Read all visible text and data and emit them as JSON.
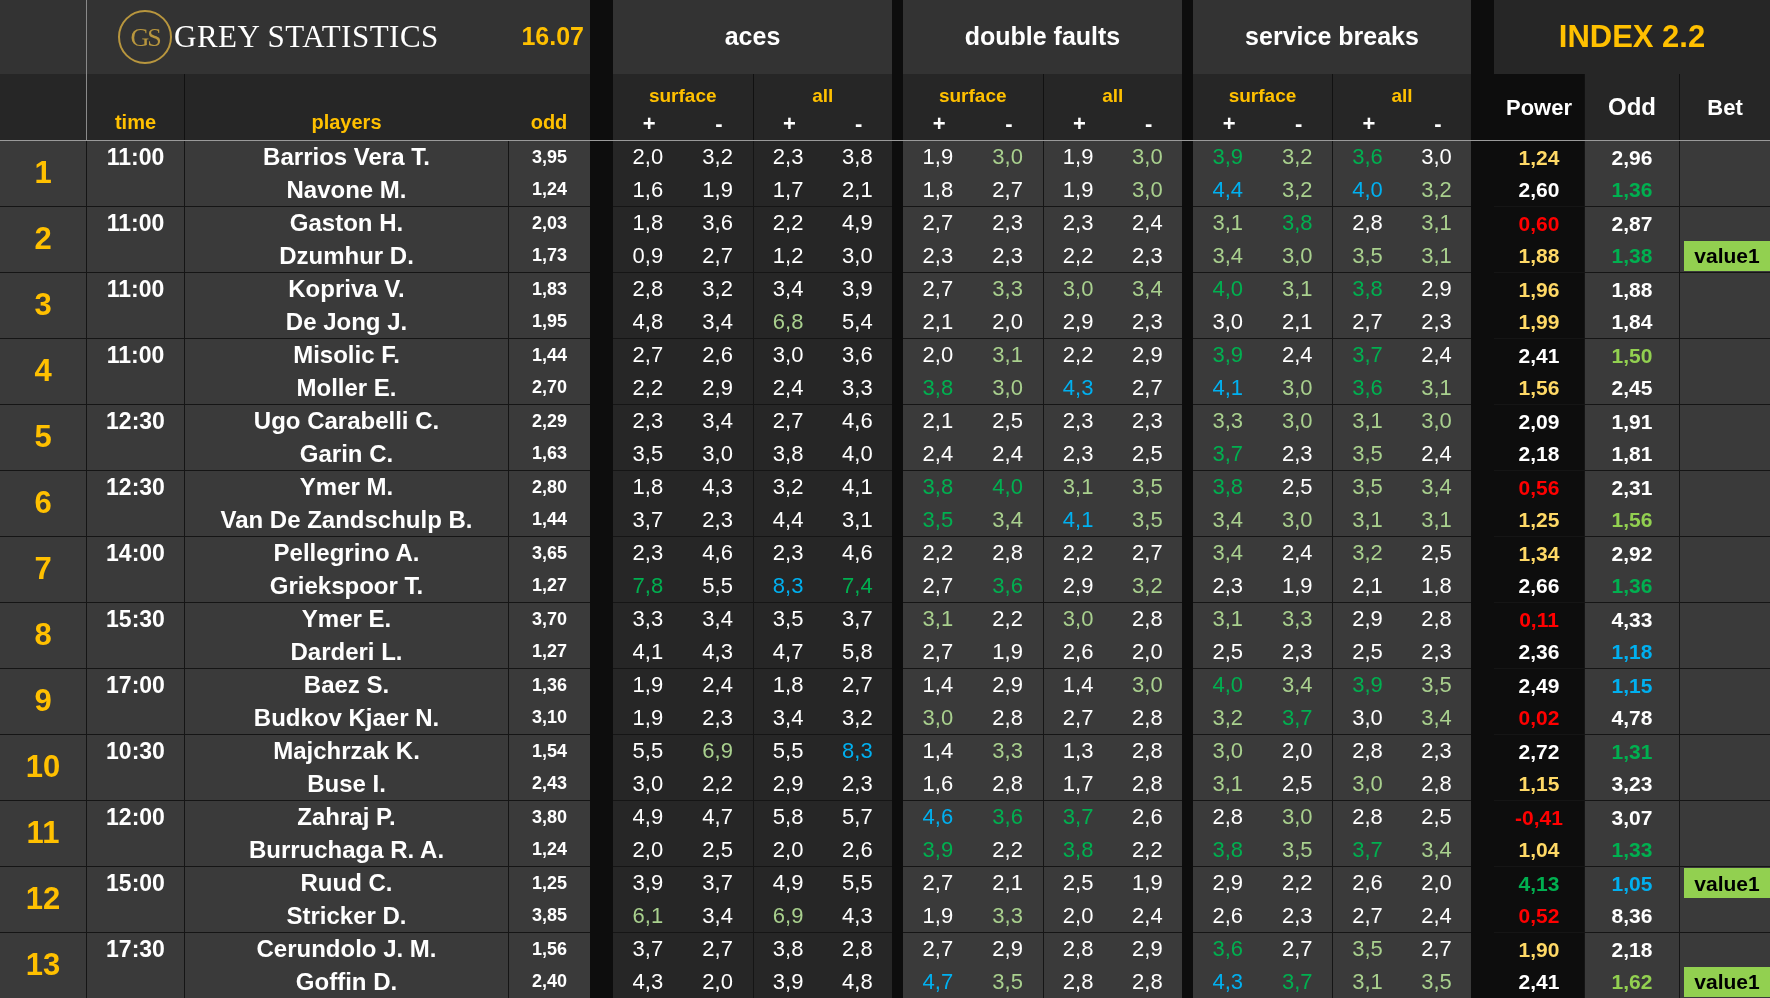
{
  "header": {
    "logo_mark": "GS",
    "brand": "GREY STATISTICS",
    "date": "16.07",
    "index_title": "INDEX 2.2",
    "groups": [
      {
        "title": "aces",
        "subs": [
          {
            "label": "surface",
            "signs": [
              "+",
              "-"
            ]
          },
          {
            "label": "all",
            "signs": [
              "+",
              "-"
            ]
          }
        ]
      },
      {
        "title": "double faults",
        "subs": [
          {
            "label": "surface",
            "signs": [
              "+",
              "-"
            ]
          },
          {
            "label": "all",
            "signs": [
              "+",
              "-"
            ]
          }
        ]
      },
      {
        "title": "service breaks",
        "subs": [
          {
            "label": "surface",
            "signs": [
              "+",
              "-"
            ]
          },
          {
            "label": "all",
            "signs": [
              "+",
              "-"
            ]
          }
        ]
      }
    ],
    "columns": {
      "time": "time",
      "players": "players",
      "odd": "odd",
      "power": "Power",
      "index_odd": "Odd",
      "bet": "Bet"
    }
  },
  "matches": [
    {
      "rank": "1",
      "time": "11:00",
      "players": [
        {
          "name": "Barrios Vera T.",
          "odd": "3,95",
          "stats": [
            {
              "text": "2,0",
              "color": "#ffffff"
            },
            {
              "text": "3,2",
              "color": "#ffffff"
            },
            {
              "text": "2,3",
              "color": "#ffffff"
            },
            {
              "text": "3,8",
              "color": "#ffffff"
            },
            {
              "text": "1,9",
              "color": "#ffffff"
            },
            {
              "text": "3,0",
              "color": "#a9d08e"
            },
            {
              "text": "1,9",
              "color": "#ffffff"
            },
            {
              "text": "3,0",
              "color": "#a9d08e"
            },
            {
              "text": "3,9",
              "color": "#00b050"
            },
            {
              "text": "3,2",
              "color": "#a9d08e"
            },
            {
              "text": "3,6",
              "color": "#00b050"
            },
            {
              "text": "3,0",
              "color": "#ffffff"
            }
          ],
          "power": {
            "text": "1,24",
            "color": "#ffd966"
          },
          "index_odd": {
            "text": "2,96",
            "color": "#ffffff"
          }
        },
        {
          "name": "Navone M.",
          "odd": "1,24",
          "stats": [
            {
              "text": "1,6",
              "color": "#ffffff"
            },
            {
              "text": "1,9",
              "color": "#ffffff"
            },
            {
              "text": "1,7",
              "color": "#ffffff"
            },
            {
              "text": "2,1",
              "color": "#ffffff"
            },
            {
              "text": "1,8",
              "color": "#ffffff"
            },
            {
              "text": "2,7",
              "color": "#ffffff"
            },
            {
              "text": "1,9",
              "color": "#ffffff"
            },
            {
              "text": "3,0",
              "color": "#a9d08e"
            },
            {
              "text": "4,4",
              "color": "#00b0f0"
            },
            {
              "text": "3,2",
              "color": "#a9d08e"
            },
            {
              "text": "4,0",
              "color": "#00b0f0"
            },
            {
              "text": "3,2",
              "color": "#a9d08e"
            }
          ],
          "power": {
            "text": "2,60",
            "color": "#ffffff"
          },
          "index_odd": {
            "text": "1,36",
            "color": "#00b050"
          }
        }
      ]
    },
    {
      "rank": "2",
      "time": "11:00",
      "players": [
        {
          "name": "Gaston H.",
          "odd": "2,03",
          "stats": [
            {
              "text": "1,8",
              "color": "#ffffff"
            },
            {
              "text": "3,6",
              "color": "#ffffff"
            },
            {
              "text": "2,2",
              "color": "#ffffff"
            },
            {
              "text": "4,9",
              "color": "#ffffff"
            },
            {
              "text": "2,7",
              "color": "#ffffff"
            },
            {
              "text": "2,3",
              "color": "#ffffff"
            },
            {
              "text": "2,3",
              "color": "#ffffff"
            },
            {
              "text": "2,4",
              "color": "#ffffff"
            },
            {
              "text": "3,1",
              "color": "#a9d08e"
            },
            {
              "text": "3,8",
              "color": "#00b050"
            },
            {
              "text": "2,8",
              "color": "#ffffff"
            },
            {
              "text": "3,1",
              "color": "#a9d08e"
            }
          ],
          "power": {
            "text": "0,60",
            "color": "#ff0000"
          },
          "index_odd": {
            "text": "2,87",
            "color": "#ffffff"
          }
        },
        {
          "name": "Dzumhur D.",
          "odd": "1,73",
          "stats": [
            {
              "text": "0,9",
              "color": "#ffffff"
            },
            {
              "text": "2,7",
              "color": "#ffffff"
            },
            {
              "text": "1,2",
              "color": "#ffffff"
            },
            {
              "text": "3,0",
              "color": "#ffffff"
            },
            {
              "text": "2,3",
              "color": "#ffffff"
            },
            {
              "text": "2,3",
              "color": "#ffffff"
            },
            {
              "text": "2,2",
              "color": "#ffffff"
            },
            {
              "text": "2,3",
              "color": "#ffffff"
            },
            {
              "text": "3,4",
              "color": "#a9d08e"
            },
            {
              "text": "3,0",
              "color": "#a9d08e"
            },
            {
              "text": "3,5",
              "color": "#a9d08e"
            },
            {
              "text": "3,1",
              "color": "#a9d08e"
            }
          ],
          "power": {
            "text": "1,88",
            "color": "#ffd966"
          },
          "index_odd": {
            "text": "1,38",
            "color": "#00b050"
          },
          "bet": "value1"
        }
      ]
    },
    {
      "rank": "3",
      "time": "11:00",
      "players": [
        {
          "name": "Kopriva V.",
          "odd": "1,83",
          "stats": [
            {
              "text": "2,8",
              "color": "#ffffff"
            },
            {
              "text": "3,2",
              "color": "#ffffff"
            },
            {
              "text": "3,4",
              "color": "#ffffff"
            },
            {
              "text": "3,9",
              "color": "#ffffff"
            },
            {
              "text": "2,7",
              "color": "#ffffff"
            },
            {
              "text": "3,3",
              "color": "#a9d08e"
            },
            {
              "text": "3,0",
              "color": "#a9d08e"
            },
            {
              "text": "3,4",
              "color": "#a9d08e"
            },
            {
              "text": "4,0",
              "color": "#00b050"
            },
            {
              "text": "3,1",
              "color": "#a9d08e"
            },
            {
              "text": "3,8",
              "color": "#00b050"
            },
            {
              "text": "2,9",
              "color": "#ffffff"
            }
          ],
          "power": {
            "text": "1,96",
            "color": "#ffd966"
          },
          "index_odd": {
            "text": "1,88",
            "color": "#ffffff"
          }
        },
        {
          "name": "De Jong J.",
          "odd": "1,95",
          "stats": [
            {
              "text": "4,8",
              "color": "#ffffff"
            },
            {
              "text": "3,4",
              "color": "#ffffff"
            },
            {
              "text": "6,8",
              "color": "#a9d08e"
            },
            {
              "text": "5,4",
              "color": "#ffffff"
            },
            {
              "text": "2,1",
              "color": "#ffffff"
            },
            {
              "text": "2,0",
              "color": "#ffffff"
            },
            {
              "text": "2,9",
              "color": "#ffffff"
            },
            {
              "text": "2,3",
              "color": "#ffffff"
            },
            {
              "text": "3,0",
              "color": "#ffffff"
            },
            {
              "text": "2,1",
              "color": "#ffffff"
            },
            {
              "text": "2,7",
              "color": "#ffffff"
            },
            {
              "text": "2,3",
              "color": "#ffffff"
            }
          ],
          "power": {
            "text": "1,99",
            "color": "#ffd966"
          },
          "index_odd": {
            "text": "1,84",
            "color": "#ffffff"
          }
        }
      ]
    },
    {
      "rank": "4",
      "time": "11:00",
      "players": [
        {
          "name": "Misolic F.",
          "odd": "1,44",
          "stats": [
            {
              "text": "2,7",
              "color": "#ffffff"
            },
            {
              "text": "2,6",
              "color": "#ffffff"
            },
            {
              "text": "3,0",
              "color": "#ffffff"
            },
            {
              "text": "3,6",
              "color": "#ffffff"
            },
            {
              "text": "2,0",
              "color": "#ffffff"
            },
            {
              "text": "3,1",
              "color": "#a9d08e"
            },
            {
              "text": "2,2",
              "color": "#ffffff"
            },
            {
              "text": "2,9",
              "color": "#ffffff"
            },
            {
              "text": "3,9",
              "color": "#00b050"
            },
            {
              "text": "2,4",
              "color": "#ffffff"
            },
            {
              "text": "3,7",
              "color": "#00b050"
            },
            {
              "text": "2,4",
              "color": "#ffffff"
            }
          ],
          "power": {
            "text": "2,41",
            "color": "#ffffff"
          },
          "index_odd": {
            "text": "1,50",
            "color": "#92d050"
          }
        },
        {
          "name": "Moller E.",
          "odd": "2,70",
          "stats": [
            {
              "text": "2,2",
              "color": "#ffffff"
            },
            {
              "text": "2,9",
              "color": "#ffffff"
            },
            {
              "text": "2,4",
              "color": "#ffffff"
            },
            {
              "text": "3,3",
              "color": "#ffffff"
            },
            {
              "text": "3,8",
              "color": "#00b050"
            },
            {
              "text": "3,0",
              "color": "#a9d08e"
            },
            {
              "text": "4,3",
              "color": "#00b0f0"
            },
            {
              "text": "2,7",
              "color": "#ffffff"
            },
            {
              "text": "4,1",
              "color": "#00b0f0"
            },
            {
              "text": "3,0",
              "color": "#a9d08e"
            },
            {
              "text": "3,6",
              "color": "#00b050"
            },
            {
              "text": "3,1",
              "color": "#a9d08e"
            }
          ],
          "power": {
            "text": "1,56",
            "color": "#ffd966"
          },
          "index_odd": {
            "text": "2,45",
            "color": "#ffffff"
          }
        }
      ]
    },
    {
      "rank": "5",
      "time": "12:30",
      "players": [
        {
          "name": "Ugo Carabelli C.",
          "odd": "2,29",
          "stats": [
            {
              "text": "2,3",
              "color": "#ffffff"
            },
            {
              "text": "3,4",
              "color": "#ffffff"
            },
            {
              "text": "2,7",
              "color": "#ffffff"
            },
            {
              "text": "4,6",
              "color": "#ffffff"
            },
            {
              "text": "2,1",
              "color": "#ffffff"
            },
            {
              "text": "2,5",
              "color": "#ffffff"
            },
            {
              "text": "2,3",
              "color": "#ffffff"
            },
            {
              "text": "2,3",
              "color": "#ffffff"
            },
            {
              "text": "3,3",
              "color": "#a9d08e"
            },
            {
              "text": "3,0",
              "color": "#a9d08e"
            },
            {
              "text": "3,1",
              "color": "#a9d08e"
            },
            {
              "text": "3,0",
              "color": "#a9d08e"
            }
          ],
          "power": {
            "text": "2,09",
            "color": "#ffffff"
          },
          "index_odd": {
            "text": "1,91",
            "color": "#ffffff"
          }
        },
        {
          "name": "Garin C.",
          "odd": "1,63",
          "stats": [
            {
              "text": "3,5",
              "color": "#ffffff"
            },
            {
              "text": "3,0",
              "color": "#ffffff"
            },
            {
              "text": "3,8",
              "color": "#ffffff"
            },
            {
              "text": "4,0",
              "color": "#ffffff"
            },
            {
              "text": "2,4",
              "color": "#ffffff"
            },
            {
              "text": "2,4",
              "color": "#ffffff"
            },
            {
              "text": "2,3",
              "color": "#ffffff"
            },
            {
              "text": "2,5",
              "color": "#ffffff"
            },
            {
              "text": "3,7",
              "color": "#00b050"
            },
            {
              "text": "2,3",
              "color": "#ffffff"
            },
            {
              "text": "3,5",
              "color": "#a9d08e"
            },
            {
              "text": "2,4",
              "color": "#ffffff"
            }
          ],
          "power": {
            "text": "2,18",
            "color": "#ffffff"
          },
          "index_odd": {
            "text": "1,81",
            "color": "#ffffff"
          }
        }
      ]
    },
    {
      "rank": "6",
      "time": "12:30",
      "players": [
        {
          "name": "Ymer M.",
          "odd": "2,80",
          "stats": [
            {
              "text": "1,8",
              "color": "#ffffff"
            },
            {
              "text": "4,3",
              "color": "#ffffff"
            },
            {
              "text": "3,2",
              "color": "#ffffff"
            },
            {
              "text": "4,1",
              "color": "#ffffff"
            },
            {
              "text": "3,8",
              "color": "#00b050"
            },
            {
              "text": "4,0",
              "color": "#00b050"
            },
            {
              "text": "3,1",
              "color": "#a9d08e"
            },
            {
              "text": "3,5",
              "color": "#a9d08e"
            },
            {
              "text": "3,8",
              "color": "#00b050"
            },
            {
              "text": "2,5",
              "color": "#ffffff"
            },
            {
              "text": "3,5",
              "color": "#a9d08e"
            },
            {
              "text": "3,4",
              "color": "#a9d08e"
            }
          ],
          "power": {
            "text": "0,56",
            "color": "#ff0000"
          },
          "index_odd": {
            "text": "2,31",
            "color": "#ffffff"
          }
        },
        {
          "name": "Van De Zandschulp B.",
          "odd": "1,44",
          "stats": [
            {
              "text": "3,7",
              "color": "#ffffff"
            },
            {
              "text": "2,3",
              "color": "#ffffff"
            },
            {
              "text": "4,4",
              "color": "#ffffff"
            },
            {
              "text": "3,1",
              "color": "#ffffff"
            },
            {
              "text": "3,5",
              "color": "#00b050"
            },
            {
              "text": "3,4",
              "color": "#a9d08e"
            },
            {
              "text": "4,1",
              "color": "#00b0f0"
            },
            {
              "text": "3,5",
              "color": "#a9d08e"
            },
            {
              "text": "3,4",
              "color": "#a9d08e"
            },
            {
              "text": "3,0",
              "color": "#a9d08e"
            },
            {
              "text": "3,1",
              "color": "#a9d08e"
            },
            {
              "text": "3,1",
              "color": "#a9d08e"
            }
          ],
          "power": {
            "text": "1,25",
            "color": "#ffd966"
          },
          "index_odd": {
            "text": "1,56",
            "color": "#92d050"
          }
        }
      ]
    },
    {
      "rank": "7",
      "time": "14:00",
      "players": [
        {
          "name": "Pellegrino A.",
          "odd": "3,65",
          "stats": [
            {
              "text": "2,3",
              "color": "#ffffff"
            },
            {
              "text": "4,6",
              "color": "#ffffff"
            },
            {
              "text": "2,3",
              "color": "#ffffff"
            },
            {
              "text": "4,6",
              "color": "#ffffff"
            },
            {
              "text": "2,2",
              "color": "#ffffff"
            },
            {
              "text": "2,8",
              "color": "#ffffff"
            },
            {
              "text": "2,2",
              "color": "#ffffff"
            },
            {
              "text": "2,7",
              "color": "#ffffff"
            },
            {
              "text": "3,4",
              "color": "#a9d08e"
            },
            {
              "text": "2,4",
              "color": "#ffffff"
            },
            {
              "text": "3,2",
              "color": "#a9d08e"
            },
            {
              "text": "2,5",
              "color": "#ffffff"
            }
          ],
          "power": {
            "text": "1,34",
            "color": "#ffd966"
          },
          "index_odd": {
            "text": "2,92",
            "color": "#ffffff"
          }
        },
        {
          "name": "Griekspoor T.",
          "odd": "1,27",
          "stats": [
            {
              "text": "7,8",
              "color": "#00b050"
            },
            {
              "text": "5,5",
              "color": "#ffffff"
            },
            {
              "text": "8,3",
              "color": "#00b0f0"
            },
            {
              "text": "7,4",
              "color": "#00b050"
            },
            {
              "text": "2,7",
              "color": "#ffffff"
            },
            {
              "text": "3,6",
              "color": "#00b050"
            },
            {
              "text": "2,9",
              "color": "#ffffff"
            },
            {
              "text": "3,2",
              "color": "#a9d08e"
            },
            {
              "text": "2,3",
              "color": "#ffffff"
            },
            {
              "text": "1,9",
              "color": "#ffffff"
            },
            {
              "text": "2,1",
              "color": "#ffffff"
            },
            {
              "text": "1,8",
              "color": "#ffffff"
            }
          ],
          "power": {
            "text": "2,66",
            "color": "#ffffff"
          },
          "index_odd": {
            "text": "1,36",
            "color": "#00b050"
          }
        }
      ]
    },
    {
      "rank": "8",
      "time": "15:30",
      "players": [
        {
          "name": "Ymer E.",
          "odd": "3,70",
          "stats": [
            {
              "text": "3,3",
              "color": "#ffffff"
            },
            {
              "text": "3,4",
              "color": "#ffffff"
            },
            {
              "text": "3,5",
              "color": "#ffffff"
            },
            {
              "text": "3,7",
              "color": "#ffffff"
            },
            {
              "text": "3,1",
              "color": "#a9d08e"
            },
            {
              "text": "2,2",
              "color": "#ffffff"
            },
            {
              "text": "3,0",
              "color": "#a9d08e"
            },
            {
              "text": "2,8",
              "color": "#ffffff"
            },
            {
              "text": "3,1",
              "color": "#a9d08e"
            },
            {
              "text": "3,3",
              "color": "#a9d08e"
            },
            {
              "text": "2,9",
              "color": "#ffffff"
            },
            {
              "text": "2,8",
              "color": "#ffffff"
            }
          ],
          "power": {
            "text": "0,11",
            "color": "#ff0000"
          },
          "index_odd": {
            "text": "4,33",
            "color": "#ffffff"
          }
        },
        {
          "name": "Darderi L.",
          "odd": "1,27",
          "stats": [
            {
              "text": "4,1",
              "color": "#ffffff"
            },
            {
              "text": "4,3",
              "color": "#ffffff"
            },
            {
              "text": "4,7",
              "color": "#ffffff"
            },
            {
              "text": "5,8",
              "color": "#ffffff"
            },
            {
              "text": "2,7",
              "color": "#ffffff"
            },
            {
              "text": "1,9",
              "color": "#ffffff"
            },
            {
              "text": "2,6",
              "color": "#ffffff"
            },
            {
              "text": "2,0",
              "color": "#ffffff"
            },
            {
              "text": "2,5",
              "color": "#ffffff"
            },
            {
              "text": "2,3",
              "color": "#ffffff"
            },
            {
              "text": "2,5",
              "color": "#ffffff"
            },
            {
              "text": "2,3",
              "color": "#ffffff"
            }
          ],
          "power": {
            "text": "2,36",
            "color": "#ffffff"
          },
          "index_odd": {
            "text": "1,18",
            "color": "#00b0f0"
          }
        }
      ]
    },
    {
      "rank": "9",
      "time": "17:00",
      "players": [
        {
          "name": "Baez S.",
          "odd": "1,36",
          "stats": [
            {
              "text": "1,9",
              "color": "#ffffff"
            },
            {
              "text": "2,4",
              "color": "#ffffff"
            },
            {
              "text": "1,8",
              "color": "#ffffff"
            },
            {
              "text": "2,7",
              "color": "#ffffff"
            },
            {
              "text": "1,4",
              "color": "#ffffff"
            },
            {
              "text": "2,9",
              "color": "#ffffff"
            },
            {
              "text": "1,4",
              "color": "#ffffff"
            },
            {
              "text": "3,0",
              "color": "#a9d08e"
            },
            {
              "text": "4,0",
              "color": "#00b050"
            },
            {
              "text": "3,4",
              "color": "#a9d08e"
            },
            {
              "text": "3,9",
              "color": "#00b050"
            },
            {
              "text": "3,5",
              "color": "#a9d08e"
            }
          ],
          "power": {
            "text": "2,49",
            "color": "#ffffff"
          },
          "index_odd": {
            "text": "1,15",
            "color": "#00b0f0"
          }
        },
        {
          "name": "Budkov Kjaer N.",
          "odd": "3,10",
          "stats": [
            {
              "text": "1,9",
              "color": "#ffffff"
            },
            {
              "text": "2,3",
              "color": "#ffffff"
            },
            {
              "text": "3,4",
              "color": "#ffffff"
            },
            {
              "text": "3,2",
              "color": "#ffffff"
            },
            {
              "text": "3,0",
              "color": "#a9d08e"
            },
            {
              "text": "2,8",
              "color": "#ffffff"
            },
            {
              "text": "2,7",
              "color": "#ffffff"
            },
            {
              "text": "2,8",
              "color": "#ffffff"
            },
            {
              "text": "3,2",
              "color": "#a9d08e"
            },
            {
              "text": "3,7",
              "color": "#00b050"
            },
            {
              "text": "3,0",
              "color": "#ffffff"
            },
            {
              "text": "3,4",
              "color": "#a9d08e"
            }
          ],
          "power": {
            "text": "0,02",
            "color": "#ff0000"
          },
          "index_odd": {
            "text": "4,78",
            "color": "#ffffff"
          }
        }
      ]
    },
    {
      "rank": "10",
      "time": "10:30",
      "players": [
        {
          "name": "Majchrzak K.",
          "odd": "1,54",
          "stats": [
            {
              "text": "5,5",
              "color": "#ffffff"
            },
            {
              "text": "6,9",
              "color": "#a9d08e"
            },
            {
              "text": "5,5",
              "color": "#ffffff"
            },
            {
              "text": "8,3",
              "color": "#00b0f0"
            },
            {
              "text": "1,4",
              "color": "#ffffff"
            },
            {
              "text": "3,3",
              "color": "#a9d08e"
            },
            {
              "text": "1,3",
              "color": "#ffffff"
            },
            {
              "text": "2,8",
              "color": "#ffffff"
            },
            {
              "text": "3,0",
              "color": "#a9d08e"
            },
            {
              "text": "2,0",
              "color": "#ffffff"
            },
            {
              "text": "2,8",
              "color": "#ffffff"
            },
            {
              "text": "2,3",
              "color": "#ffffff"
            }
          ],
          "power": {
            "text": "2,72",
            "color": "#ffffff"
          },
          "index_odd": {
            "text": "1,31",
            "color": "#00b050"
          }
        },
        {
          "name": "Buse I.",
          "odd": "2,43",
          "stats": [
            {
              "text": "3,0",
              "color": "#ffffff"
            },
            {
              "text": "2,2",
              "color": "#ffffff"
            },
            {
              "text": "2,9",
              "color": "#ffffff"
            },
            {
              "text": "2,3",
              "color": "#ffffff"
            },
            {
              "text": "1,6",
              "color": "#ffffff"
            },
            {
              "text": "2,8",
              "color": "#ffffff"
            },
            {
              "text": "1,7",
              "color": "#ffffff"
            },
            {
              "text": "2,8",
              "color": "#ffffff"
            },
            {
              "text": "3,1",
              "color": "#a9d08e"
            },
            {
              "text": "2,5",
              "color": "#ffffff"
            },
            {
              "text": "3,0",
              "color": "#a9d08e"
            },
            {
              "text": "2,8",
              "color": "#ffffff"
            }
          ],
          "power": {
            "text": "1,15",
            "color": "#ffd966"
          },
          "index_odd": {
            "text": "3,23",
            "color": "#ffffff"
          }
        }
      ]
    },
    {
      "rank": "11",
      "time": "12:00",
      "players": [
        {
          "name": "Zahraj P.",
          "odd": "3,80",
          "stats": [
            {
              "text": "4,9",
              "color": "#ffffff"
            },
            {
              "text": "4,7",
              "color": "#ffffff"
            },
            {
              "text": "5,8",
              "color": "#ffffff"
            },
            {
              "text": "5,7",
              "color": "#ffffff"
            },
            {
              "text": "4,6",
              "color": "#00b0f0"
            },
            {
              "text": "3,6",
              "color": "#00b050"
            },
            {
              "text": "3,7",
              "color": "#00b050"
            },
            {
              "text": "2,6",
              "color": "#ffffff"
            },
            {
              "text": "2,8",
              "color": "#ffffff"
            },
            {
              "text": "3,0",
              "color": "#a9d08e"
            },
            {
              "text": "2,8",
              "color": "#ffffff"
            },
            {
              "text": "2,5",
              "color": "#ffffff"
            }
          ],
          "power": {
            "text": "-0,41",
            "color": "#ff0000"
          },
          "index_odd": {
            "text": "3,07",
            "color": "#ffffff"
          }
        },
        {
          "name": "Burruchaga R. A.",
          "odd": "1,24",
          "stats": [
            {
              "text": "2,0",
              "color": "#ffffff"
            },
            {
              "text": "2,5",
              "color": "#ffffff"
            },
            {
              "text": "2,0",
              "color": "#ffffff"
            },
            {
              "text": "2,6",
              "color": "#ffffff"
            },
            {
              "text": "3,9",
              "color": "#00b050"
            },
            {
              "text": "2,2",
              "color": "#ffffff"
            },
            {
              "text": "3,8",
              "color": "#00b050"
            },
            {
              "text": "2,2",
              "color": "#ffffff"
            },
            {
              "text": "3,8",
              "color": "#00b050"
            },
            {
              "text": "3,5",
              "color": "#a9d08e"
            },
            {
              "text": "3,7",
              "color": "#00b050"
            },
            {
              "text": "3,4",
              "color": "#a9d08e"
            }
          ],
          "power": {
            "text": "1,04",
            "color": "#ffd966"
          },
          "index_odd": {
            "text": "1,33",
            "color": "#00b050"
          }
        }
      ]
    },
    {
      "rank": "12",
      "time": "15:00",
      "players": [
        {
          "name": "Ruud C.",
          "odd": "1,25",
          "stats": [
            {
              "text": "3,9",
              "color": "#ffffff"
            },
            {
              "text": "3,7",
              "color": "#ffffff"
            },
            {
              "text": "4,9",
              "color": "#ffffff"
            },
            {
              "text": "5,5",
              "color": "#ffffff"
            },
            {
              "text": "2,7",
              "color": "#ffffff"
            },
            {
              "text": "2,1",
              "color": "#ffffff"
            },
            {
              "text": "2,5",
              "color": "#ffffff"
            },
            {
              "text": "1,9",
              "color": "#ffffff"
            },
            {
              "text": "2,9",
              "color": "#ffffff"
            },
            {
              "text": "2,2",
              "color": "#ffffff"
            },
            {
              "text": "2,6",
              "color": "#ffffff"
            },
            {
              "text": "2,0",
              "color": "#ffffff"
            }
          ],
          "power": {
            "text": "4,13",
            "color": "#00b050"
          },
          "index_odd": {
            "text": "1,05",
            "color": "#00b0f0"
          },
          "bet": "value1"
        },
        {
          "name": "Stricker D.",
          "odd": "3,85",
          "stats": [
            {
              "text": "6,1",
              "color": "#a9d08e"
            },
            {
              "text": "3,4",
              "color": "#ffffff"
            },
            {
              "text": "6,9",
              "color": "#a9d08e"
            },
            {
              "text": "4,3",
              "color": "#ffffff"
            },
            {
              "text": "1,9",
              "color": "#ffffff"
            },
            {
              "text": "3,3",
              "color": "#a9d08e"
            },
            {
              "text": "2,0",
              "color": "#ffffff"
            },
            {
              "text": "2,4",
              "color": "#ffffff"
            },
            {
              "text": "2,6",
              "color": "#ffffff"
            },
            {
              "text": "2,3",
              "color": "#ffffff"
            },
            {
              "text": "2,7",
              "color": "#ffffff"
            },
            {
              "text": "2,4",
              "color": "#ffffff"
            }
          ],
          "power": {
            "text": "0,52",
            "color": "#ff0000"
          },
          "index_odd": {
            "text": "8,36",
            "color": "#ffffff"
          }
        }
      ]
    },
    {
      "rank": "13",
      "time": "17:30",
      "players": [
        {
          "name": "Cerundolo J. M.",
          "odd": "1,56",
          "stats": [
            {
              "text": "3,7",
              "color": "#ffffff"
            },
            {
              "text": "2,7",
              "color": "#ffffff"
            },
            {
              "text": "3,8",
              "color": "#ffffff"
            },
            {
              "text": "2,8",
              "color": "#ffffff"
            },
            {
              "text": "2,7",
              "color": "#ffffff"
            },
            {
              "text": "2,9",
              "color": "#ffffff"
            },
            {
              "text": "2,8",
              "color": "#ffffff"
            },
            {
              "text": "2,9",
              "color": "#ffffff"
            },
            {
              "text": "3,6",
              "color": "#00b050"
            },
            {
              "text": "2,7",
              "color": "#ffffff"
            },
            {
              "text": "3,5",
              "color": "#a9d08e"
            },
            {
              "text": "2,7",
              "color": "#ffffff"
            }
          ],
          "power": {
            "text": "1,90",
            "color": "#ffd966"
          },
          "index_odd": {
            "text": "2,18",
            "color": "#ffffff"
          }
        },
        {
          "name": "Goffin D.",
          "odd": "2,40",
          "stats": [
            {
              "text": "4,3",
              "color": "#ffffff"
            },
            {
              "text": "2,0",
              "color": "#ffffff"
            },
            {
              "text": "3,9",
              "color": "#ffffff"
            },
            {
              "text": "4,8",
              "color": "#ffffff"
            },
            {
              "text": "4,7",
              "color": "#00b0f0"
            },
            {
              "text": "3,5",
              "color": "#a9d08e"
            },
            {
              "text": "2,8",
              "color": "#ffffff"
            },
            {
              "text": "2,8",
              "color": "#ffffff"
            },
            {
              "text": "4,3",
              "color": "#00b0f0"
            },
            {
              "text": "3,7",
              "color": "#00b050"
            },
            {
              "text": "3,1",
              "color": "#a9d08e"
            },
            {
              "text": "3,5",
              "color": "#a9d08e"
            }
          ],
          "power": {
            "text": "2,41",
            "color": "#ffffff"
          },
          "index_odd": {
            "text": "1,62",
            "color": "#92d050"
          },
          "bet": "value1"
        }
      ]
    }
  ]
}
